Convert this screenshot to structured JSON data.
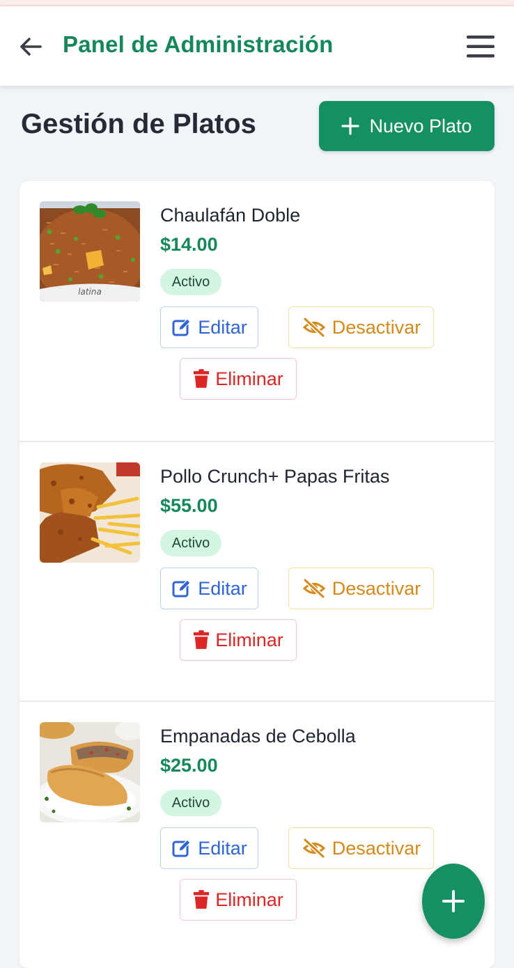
{
  "header": {
    "title": "Panel de Administración",
    "back_icon": "arrow-left-icon",
    "menu_icon": "hamburger-menu-icon"
  },
  "page": {
    "title": "Gestión de Platos",
    "new_button_label": "Nuevo Plato"
  },
  "dishes": [
    {
      "name": "Chaulafán Doble",
      "price": "$14.00",
      "status": "Activo",
      "image": "fried-rice-photo",
      "edit_label": "Editar",
      "deactivate_label": "Desactivar",
      "delete_label": "Eliminar"
    },
    {
      "name": "Pollo Crunch+ Papas Fritas",
      "price": "$55.00",
      "status": "Activo",
      "image": "fried-chicken-fries-photo",
      "edit_label": "Editar",
      "deactivate_label": "Desactivar",
      "delete_label": "Eliminar"
    },
    {
      "name": "Empanadas de Cebolla",
      "price": "$25.00",
      "status": "Activo",
      "image": "empanadas-photo",
      "edit_label": "Editar",
      "deactivate_label": "Desactivar",
      "delete_label": "Eliminar"
    }
  ],
  "colors": {
    "brand_green": "#14875b",
    "button_green": "#159063",
    "edit_blue": "#2f64d6",
    "deactivate_amber": "#d48a1a",
    "delete_red": "#dc2626",
    "active_badge_bg": "#d5f5e3"
  },
  "fab": {
    "icon": "plus-icon"
  }
}
